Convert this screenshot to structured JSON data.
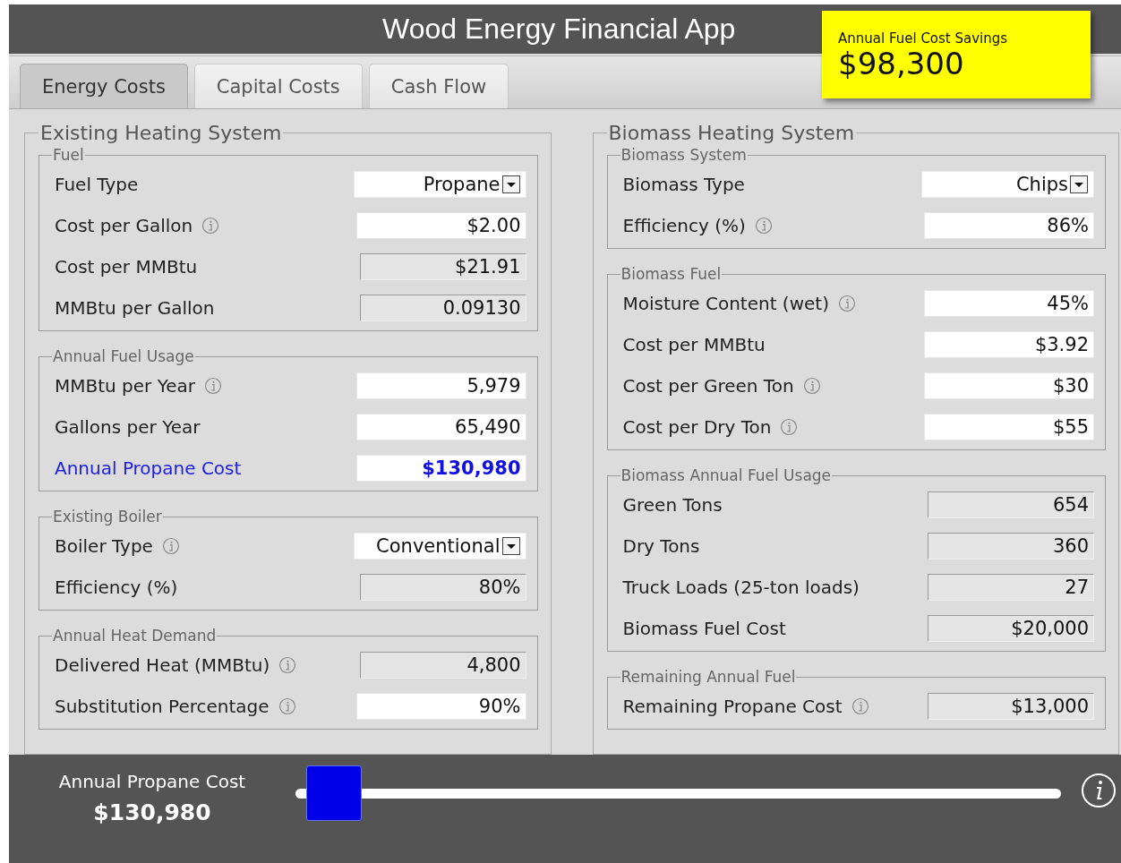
{
  "window": {
    "title": "Wood Energy Financial App"
  },
  "savings": {
    "label": "Annual Fuel Cost Savings",
    "value": "$98,300"
  },
  "tabs": [
    {
      "label": "Energy Costs",
      "selected": true
    },
    {
      "label": "Capital Costs",
      "selected": false
    },
    {
      "label": "Cash Flow",
      "selected": false
    }
  ],
  "columns": [
    {
      "title": "Existing Heating System",
      "groups": [
        {
          "title": "Fuel",
          "rows": [
            {
              "label": "Fuel Type",
              "kind": "select",
              "value": "Propane",
              "info": false,
              "emphasis": false
            },
            {
              "label": "Cost per Gallon",
              "kind": "input",
              "value": "$2.00",
              "info": true,
              "emphasis": false
            },
            {
              "label": "Cost per MMBtu",
              "kind": "readonly",
              "value": "$21.91",
              "info": false,
              "emphasis": false
            },
            {
              "label": "MMBtu per Gallon",
              "kind": "readonly",
              "value": "0.09130",
              "info": false,
              "emphasis": false
            }
          ]
        },
        {
          "title": "Annual Fuel Usage",
          "rows": [
            {
              "label": "MMBtu per Year",
              "kind": "input",
              "value": "5,979",
              "info": true,
              "emphasis": false
            },
            {
              "label": "Gallons per Year",
              "kind": "input",
              "value": "65,490",
              "info": false,
              "emphasis": false
            },
            {
              "label": "Annual Propane Cost",
              "kind": "input",
              "value": "$130,980",
              "info": false,
              "emphasis": true
            }
          ]
        },
        {
          "title": "Existing Boiler",
          "rows": [
            {
              "label": "Boiler Type",
              "kind": "select",
              "value": "Conventional",
              "info": true,
              "emphasis": false
            },
            {
              "label": "Efficiency (%)",
              "kind": "readonly",
              "value": "80%",
              "info": false,
              "emphasis": false
            }
          ]
        },
        {
          "title": "Annual Heat Demand",
          "rows": [
            {
              "label": "Delivered Heat (MMBtu)",
              "kind": "readonly",
              "value": "4,800",
              "info": true,
              "emphasis": false
            },
            {
              "label": "Substitution Percentage",
              "kind": "input",
              "value": "90%",
              "info": true,
              "emphasis": false
            }
          ]
        }
      ]
    },
    {
      "title": "Biomass Heating System",
      "groups": [
        {
          "title": "Biomass System",
          "rows": [
            {
              "label": "Biomass Type",
              "kind": "select",
              "value": "Chips",
              "info": false,
              "emphasis": false
            },
            {
              "label": "Efficiency (%)",
              "kind": "input",
              "value": "86%",
              "info": true,
              "emphasis": false
            }
          ]
        },
        {
          "title": "Biomass Fuel",
          "rows": [
            {
              "label": "Moisture Content (wet)",
              "kind": "input",
              "value": "45%",
              "info": true,
              "emphasis": false
            },
            {
              "label": "Cost per MMBtu",
              "kind": "input",
              "value": "$3.92",
              "info": false,
              "emphasis": false
            },
            {
              "label": "Cost per Green Ton",
              "kind": "input",
              "value": "$30",
              "info": true,
              "emphasis": false
            },
            {
              "label": "Cost per Dry Ton",
              "kind": "input",
              "value": "$55",
              "info": true,
              "emphasis": false
            }
          ]
        },
        {
          "title": "Biomass Annual Fuel Usage",
          "rows": [
            {
              "label": "Green Tons",
              "kind": "readonly",
              "value": "654",
              "info": false,
              "emphasis": false
            },
            {
              "label": "Dry Tons",
              "kind": "readonly",
              "value": "360",
              "info": false,
              "emphasis": false
            },
            {
              "label": "Truck Loads (25-ton loads)",
              "kind": "readonly",
              "value": "27",
              "info": false,
              "emphasis": false
            },
            {
              "label": "Biomass Fuel Cost",
              "kind": "readonly",
              "value": "$20,000",
              "info": false,
              "emphasis": false
            }
          ]
        },
        {
          "title": "Remaining Annual Fuel",
          "rows": [
            {
              "label": "Remaining Propane Cost",
              "kind": "readonly",
              "value": "$13,000",
              "info": true,
              "emphasis": false
            }
          ]
        }
      ]
    }
  ],
  "footer": {
    "label": "Annual Propane Cost",
    "value": "$130,980",
    "level": 0.05
  }
}
